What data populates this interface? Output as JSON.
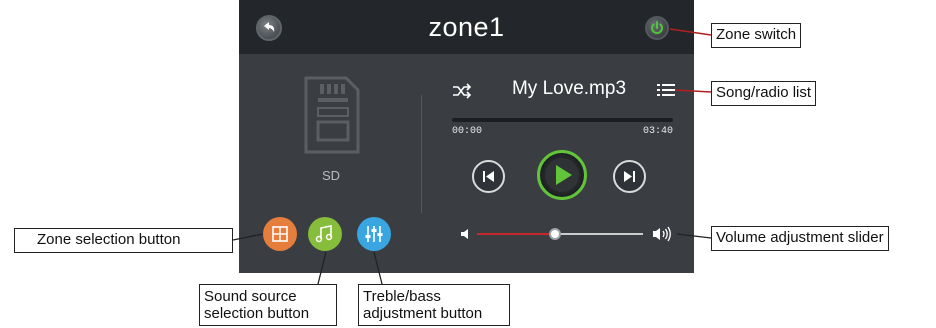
{
  "screen": {
    "title": "zone1",
    "back_icon": "back-arrow-icon",
    "power_icon": "power-icon",
    "sd_label": "SD",
    "song_title": "My Love.mp3",
    "time_elapsed": "00:00",
    "time_total": "03:40",
    "progress_fraction": 0.0,
    "volume_fraction": 0.47
  },
  "callouts": {
    "zone_switch": "Zone switch",
    "song_list": "Song/radio list",
    "zone_selection": "Zone selection button",
    "volume": "Volume adjustment slider",
    "source_line1": "Sound source",
    "source_line2": "selection button",
    "eq_line1": "Treble/bass",
    "eq_line2": "adjustment button"
  },
  "colors": {
    "screen_bg": "#3a3e42",
    "topbar_bg": "#23262a",
    "play_accent": "#62c43b",
    "zone_button": "#e57e3c",
    "source_button": "#86bd3a",
    "eq_button": "#39a6e2",
    "volume_fill": "#c4282b",
    "leader_line": "#b02020"
  }
}
